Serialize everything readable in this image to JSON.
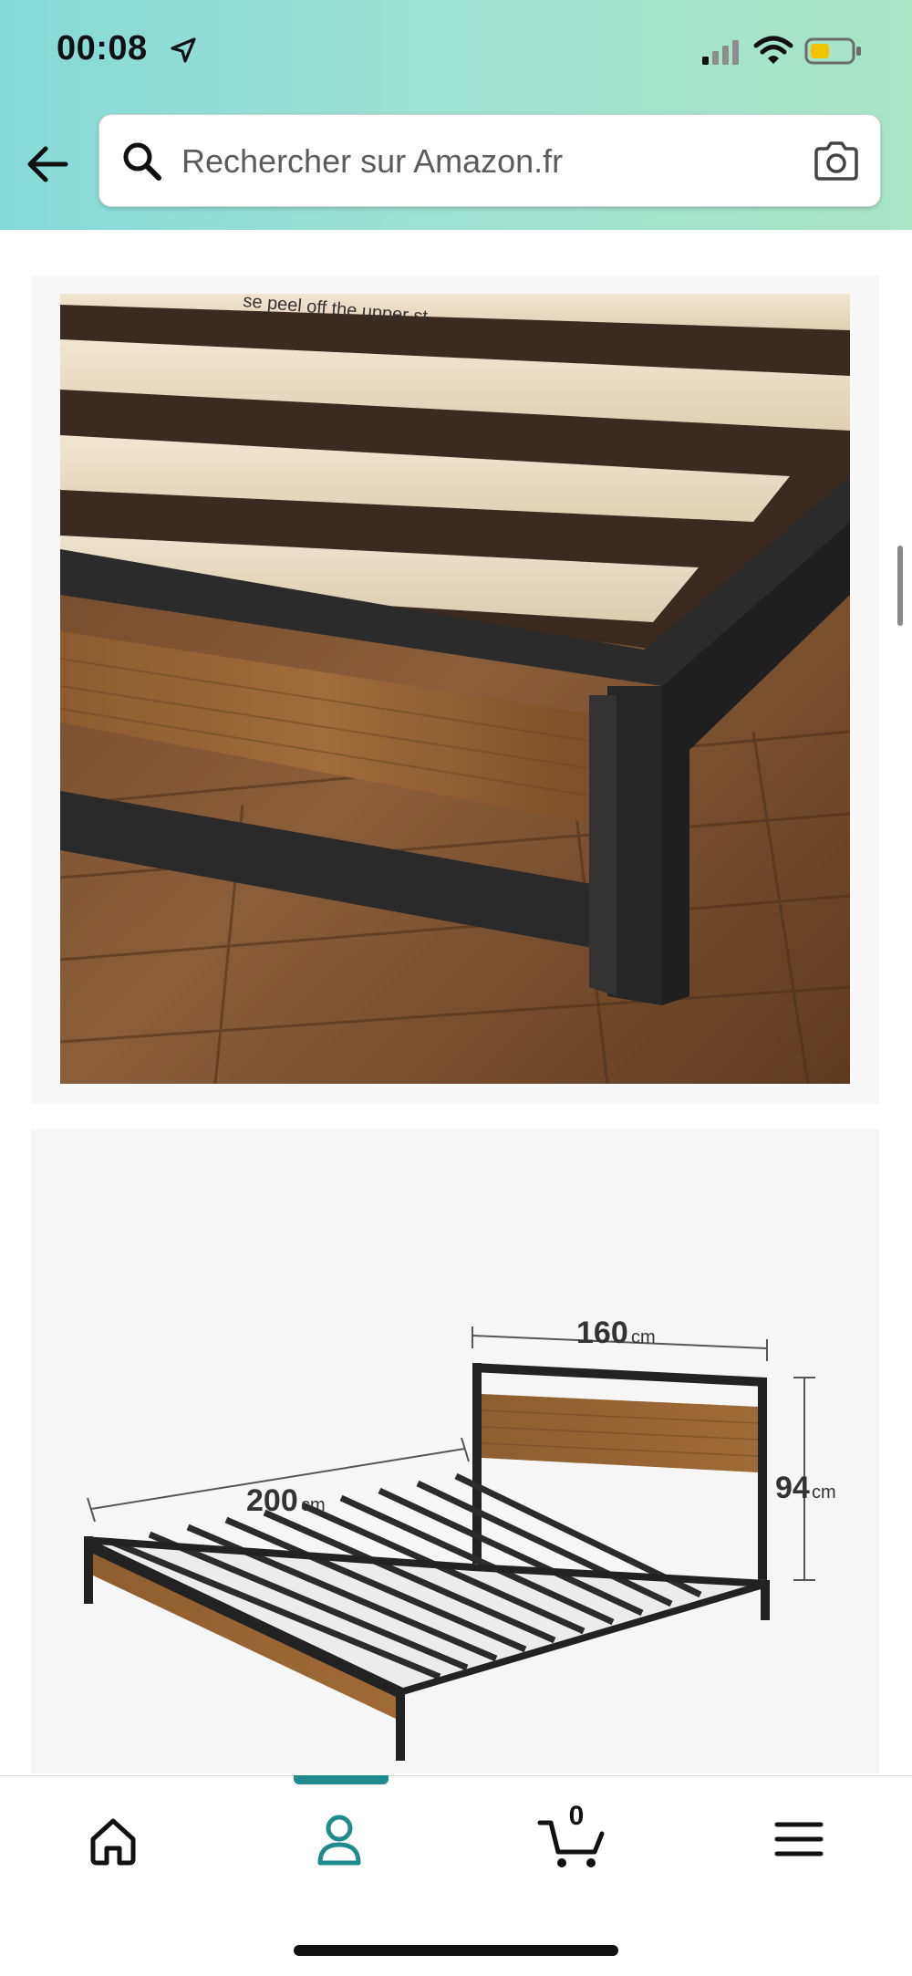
{
  "status_bar": {
    "time": "00:08"
  },
  "search": {
    "placeholder": "Rechercher sur Amazon.fr"
  },
  "product_images": {
    "photo_label": "se peel off the upper st",
    "dimensions": {
      "width_value": "160",
      "width_unit": "cm",
      "length_value": "200",
      "length_unit": "cm",
      "height_value": "94",
      "height_unit": "cm"
    }
  },
  "bottom_nav": {
    "cart_count": "0",
    "items": [
      {
        "icon": "home-icon"
      },
      {
        "icon": "account-icon"
      },
      {
        "icon": "cart-icon"
      },
      {
        "icon": "menu-icon"
      }
    ]
  },
  "colors": {
    "header_gradient_start": "#86d9d9",
    "header_gradient_end": "#a9e5c7",
    "active_tab": "#1f8b8f",
    "battery_fill": "#f2c400",
    "wood": "#8a5a2e",
    "metal": "#2b2b2b"
  }
}
